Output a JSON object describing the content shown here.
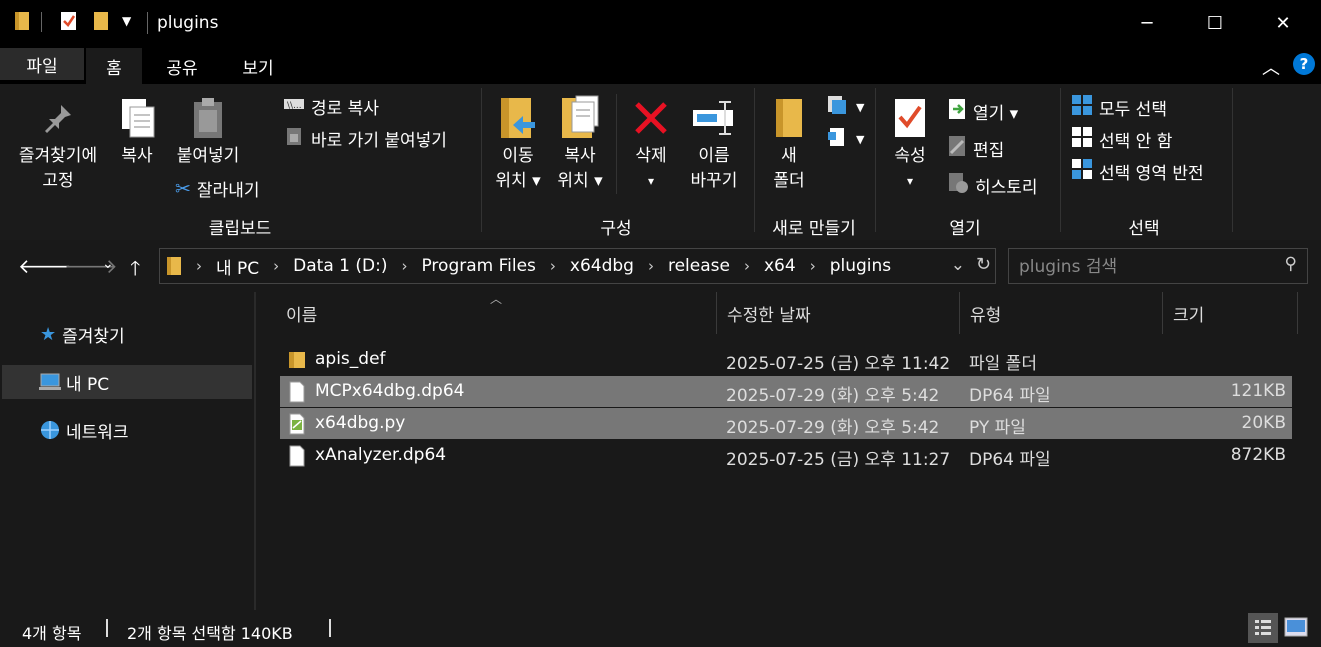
{
  "window": {
    "title": "plugins",
    "minimize": "─",
    "maximize": "☐",
    "close": "✕"
  },
  "ribbon_tabs": [
    "파일",
    "홈",
    "공유",
    "보기"
  ],
  "ribbon": {
    "clipboard": {
      "pin_line1": "즐겨찾기에",
      "pin_line2": "고정",
      "copy": "복사",
      "paste": "붙여넣기",
      "copy_path": "경로 복사",
      "paste_shortcut": "바로 가기 붙여넣기",
      "cut": "잘라내기",
      "label": "클립보드"
    },
    "organize": {
      "move_line1": "이동",
      "move_line2": "위치 ▾",
      "copyto_line1": "복사",
      "copyto_line2": "위치 ▾",
      "delete_line1": "삭제",
      "delete_line2": "▾",
      "rename_line1": "이름",
      "rename_line2": "바꾸기",
      "label": "구성"
    },
    "new": {
      "folder_line1": "새",
      "folder_line2": "폴더",
      "label": "새로 만들기"
    },
    "open": {
      "props_line1": "속성",
      "props_line2": "▾",
      "open": "열기 ▾",
      "edit": "편집",
      "history": "히스토리",
      "label": "열기"
    },
    "select": {
      "select_all": "모두 선택",
      "select_none": "선택 안 함",
      "invert": "선택 영역 반전",
      "label": "선택"
    }
  },
  "address": {
    "crumbs": [
      "내 PC",
      "Data 1 (D:)",
      "Program Files",
      "x64dbg",
      "release",
      "x64",
      "plugins"
    ],
    "search_placeholder": "plugins 검색"
  },
  "nav_pane": {
    "items": [
      "즐겨찾기",
      "내 PC",
      "네트워크"
    ]
  },
  "columns": [
    "이름",
    "수정한 날짜",
    "유형",
    "크기"
  ],
  "files": [
    {
      "name": "apis_def",
      "date": "2025-07-25 (금) 오후 11:42",
      "type": "파일 폴더",
      "size": ""
    },
    {
      "name": "MCPx64dbg.dp64",
      "date": "2025-07-29 (화) 오후 5:42",
      "type": "DP64 파일",
      "size": "121KB"
    },
    {
      "name": "x64dbg.py",
      "date": "2025-07-29 (화) 오후 5:42",
      "type": "PY 파일",
      "size": "20KB"
    },
    {
      "name": "xAnalyzer.dp64",
      "date": "2025-07-25 (금) 오후 11:27",
      "type": "DP64 파일",
      "size": "872KB"
    }
  ],
  "status": {
    "item_count": "4개 항목",
    "selection": "2개 항목 선택함 140KB"
  },
  "colors": {
    "accent_blue": "#0078d7",
    "folder_yellow": "#e8b84a",
    "delete_red": "#e81123",
    "selected_row": "#777777"
  }
}
